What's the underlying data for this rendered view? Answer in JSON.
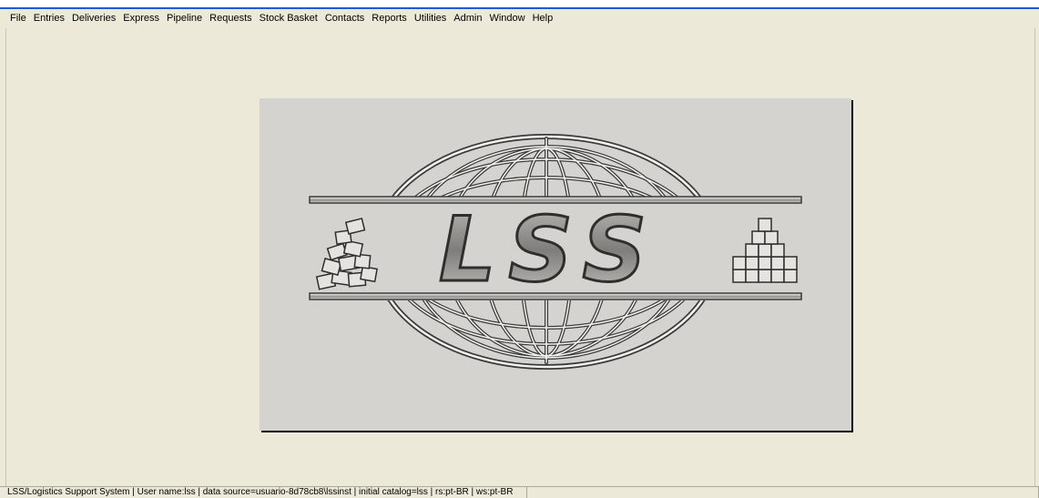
{
  "menu": [
    "File",
    "Entries",
    "Deliveries",
    "Express",
    "Pipeline",
    "Requests",
    "Stock Basket",
    "Contacts",
    "Reports",
    "Utilities",
    "Admin",
    "Window",
    "Help"
  ],
  "logo": {
    "text": "LSS"
  },
  "status": {
    "text": "LSS/Logistics Support System | User name:lss | data source=usuario-8d78cb8\\lssinst | initial catalog=lss | rs:pt-BR | ws:pt-BR"
  },
  "colors": {
    "title_accent": "#1c5bd3",
    "background": "#ece9d8",
    "panel": "#d5d3cf"
  }
}
